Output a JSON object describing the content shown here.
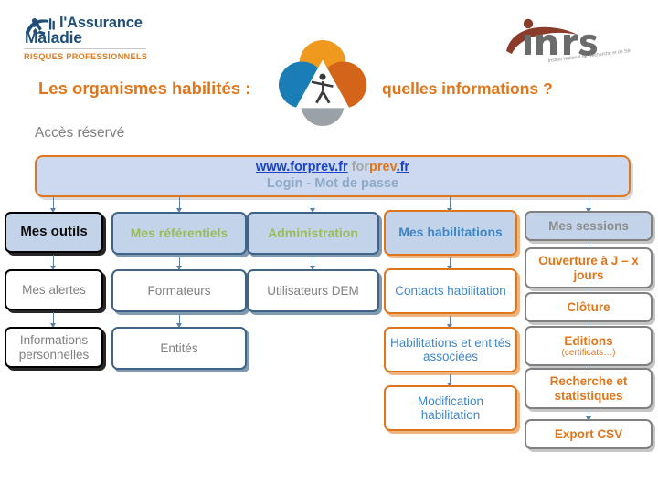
{
  "header": {
    "assurance_logo": {
      "line1": "l'Assurance",
      "line2": "Maladie",
      "subtitle": "RISQUES PROFESSIONNELS",
      "color": "#1f4e79",
      "accent": "#e07b20"
    },
    "inrs_logo": {
      "wordmark": "inrs",
      "tagline": "Institut National de Recherche et de Sécurité",
      "color": "#8a3b2a"
    },
    "title_left": "Les organismes habilités :",
    "title_right": "quelles informations ?",
    "title_color": "#e0761c",
    "access_note": "Accès réservé",
    "access_note_color": "#7f7f7f"
  },
  "banner": {
    "url_www": "www.forprev.fr",
    "url_for": "for",
    "url_prev": "prev",
    "url_fr": ".fr",
    "login_line": "Login - Mot de passe",
    "fill": "#ccd9ee",
    "border": "#e0761c"
  },
  "columns": [
    {
      "key": "mes-outils",
      "head": "Mes outils",
      "items": [
        "Mes alertes",
        "Informations personnelles"
      ],
      "border_color": "#000000",
      "text_color": "#808080"
    },
    {
      "key": "mes-referentiels",
      "head": "Mes référentiels",
      "items": [
        "Formateurs",
        "Entités"
      ],
      "border_color": "#3e6487",
      "head_text_color": "#9bbb59"
    },
    {
      "key": "administration",
      "head": "Administration",
      "items": [
        "Utilisateurs DEM"
      ],
      "border_color": "#3e6487",
      "head_text_color": "#9bbb59"
    },
    {
      "key": "mes-habilitations",
      "head": "Mes habilitations",
      "items": [
        "Contacts habilitation",
        "Habilitations et entités associées",
        "Modification habilitation"
      ],
      "border_color": "#e0761c",
      "text_color": "#3f86c7"
    },
    {
      "key": "mes-sessions",
      "head": "Mes sessions",
      "items": [
        "Ouverture à J – x jours",
        "Clôture",
        "Editions",
        "Recherche et statistiques",
        "Export CSV"
      ],
      "editions_note": "(certificats…)",
      "border_color": "#808080",
      "text_color": "#e0761c"
    }
  ]
}
